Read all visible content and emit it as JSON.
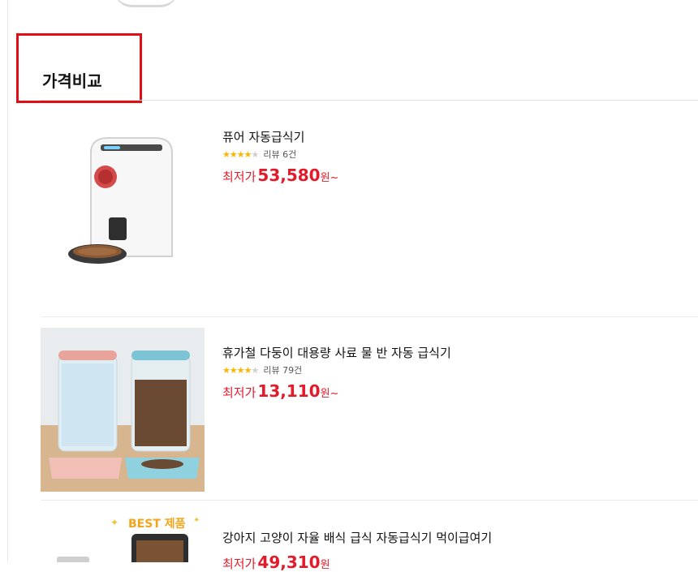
{
  "section": {
    "title": "가격비교"
  },
  "products": [
    {
      "name": "퓨어 자동급식기",
      "rating": 4.5,
      "stars": "★★★★",
      "stars_off": "★",
      "review_label": "리뷰 6건",
      "price_label": "최저가",
      "price": "53,580",
      "price_suffix": "원~"
    },
    {
      "name": "휴가철 다둥이 대용량 사료 물 반 자동 급식기",
      "rating": 4,
      "stars": "★★★★",
      "stars_off": "★",
      "review_label": "리뷰 79건",
      "price_label": "최저가",
      "price": "13,110",
      "price_suffix": "원~"
    },
    {
      "name": "강아지 고양이 자율 배식 급식 자동급식기 먹이급여기",
      "badge": "BEST 제품",
      "price_label": "최저가",
      "price": "49,310",
      "price_suffix": "원"
    }
  ],
  "colors": {
    "accent": "#e21b2b",
    "highlight": "#e10e15",
    "star": "#ffb400"
  }
}
